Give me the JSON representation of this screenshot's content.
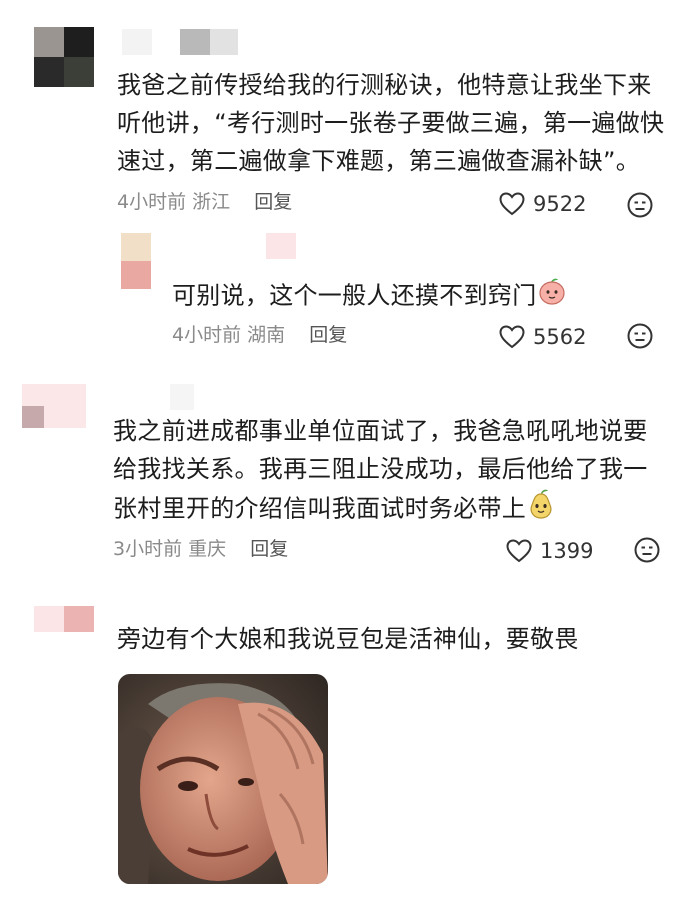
{
  "comments": [
    {
      "text_lines": [
        "我爸之前传授给我的行测秘诀，他特意让我坐下来",
        "听他讲，“考行测时一张卷子要做三遍，第一遍做快",
        "速过，第二遍做拿下难题，第三遍做查漏补缺”。"
      ],
      "time": "4小时前",
      "location": "浙江",
      "reply": "回复",
      "likes": "9522"
    },
    {
      "text": "可别说，这个一般人还摸不到窍门",
      "time": "4小时前",
      "location": "湖南",
      "reply": "回复",
      "likes": "5562"
    },
    {
      "text_lines": [
        "我之前进成都事业单位面试了，我爸急吼吼地说要",
        "给我找关系。我再三阻止没成功，最后他给了我一",
        "张村里开的介绍信叫我面试时务必带上"
      ],
      "time": "3小时前",
      "location": "重庆",
      "reply": "回复",
      "likes": "1399"
    },
    {
      "text": "旁边有个大娘和我说豆包是活神仙，要敬畏"
    }
  ],
  "icons": {
    "like": "heart-outline-icon",
    "dislike": "neutral-face-icon",
    "sticker_peach": "peach-sticker",
    "sticker_pear": "pear-sticker"
  },
  "colors": {
    "text": "#1d1d1d",
    "meta": "#8a8a8a",
    "placeholder_pink": "#f6dada",
    "placeholder_gray": "#b8b8b8"
  }
}
